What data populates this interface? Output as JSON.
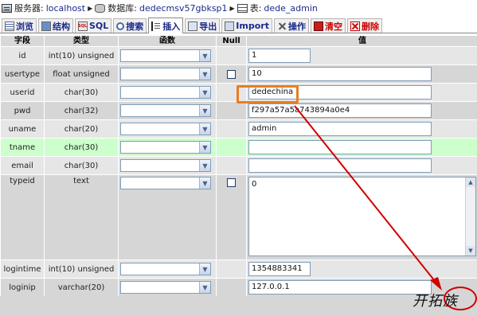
{
  "breadcrumb": {
    "server_label": "服务器:",
    "server_value": "localhost",
    "database_label": "数据库:",
    "database_value": "dedecmsv57gbksp1",
    "table_label": "表:",
    "table_value": "dede_admin"
  },
  "tabs": [
    {
      "label": "浏览",
      "icon": "browse-icon"
    },
    {
      "label": "结构",
      "icon": "structure-icon"
    },
    {
      "label": "SQL",
      "icon": "sql-icon"
    },
    {
      "label": "搜索",
      "icon": "search-icon"
    },
    {
      "label": "插入",
      "icon": "insert-icon",
      "active": true
    },
    {
      "label": "导出",
      "icon": "export-icon"
    },
    {
      "label": "Import",
      "icon": "import-icon"
    },
    {
      "label": "操作",
      "icon": "operations-icon"
    },
    {
      "label": "清空",
      "icon": "empty-icon"
    },
    {
      "label": "删除",
      "icon": "drop-icon"
    }
  ],
  "columns": {
    "field": "字段",
    "type": "类型",
    "function": "函数",
    "null": "Null",
    "value": "值"
  },
  "rows": [
    {
      "name": "id",
      "type": "int(10) unsigned",
      "value": "1"
    },
    {
      "name": "usertype",
      "type": "float unsigned",
      "value": "10",
      "null_checkbox": true
    },
    {
      "name": "userid",
      "type": "char(30)",
      "value": "dedechina"
    },
    {
      "name": "pwd",
      "type": "char(32)",
      "value": "f297a57a5a743894a0e4"
    },
    {
      "name": "uname",
      "type": "char(20)",
      "value": "admin"
    },
    {
      "name": "tname",
      "type": "char(30)",
      "value": ""
    },
    {
      "name": "email",
      "type": "char(30)",
      "value": ""
    },
    {
      "name": "typeid",
      "type": "text",
      "value": "0",
      "null_checkbox": true
    },
    {
      "name": "logintime",
      "type": "int(10) unsigned",
      "value": "1354883341"
    },
    {
      "name": "loginip",
      "type": "varchar(20)",
      "value": "127.0.0.1"
    }
  ],
  "annotations": {
    "highlight_color": "#e67e22",
    "arrow_color": "#d00000",
    "watermark": "开拓族"
  }
}
